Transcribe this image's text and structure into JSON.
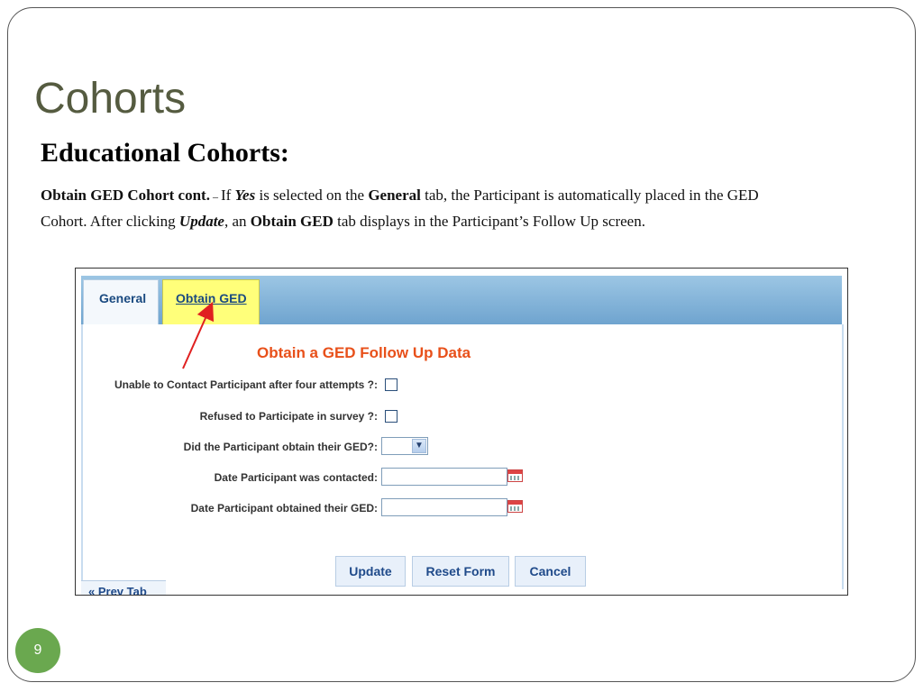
{
  "slide": {
    "title": "Cohorts",
    "subtitle": "Educational Cohorts:",
    "paragraph": {
      "lead": "Obtain GED Cohort cont.",
      "dash": " – ",
      "t1": "If ",
      "yes": "Yes",
      "t2": " is selected on the ",
      "general": "General",
      "t3": " tab, the Participant is automatically placed in the GED Cohort.  After clicking ",
      "update": "Update",
      "t4": ", an ",
      "obtain_ged": "Obtain GED",
      "t5": " tab displays in the Participant’s Follow Up screen."
    },
    "page_number": "9"
  },
  "screenshot": {
    "tabs": [
      {
        "label": "General",
        "active": false
      },
      {
        "label": "Obtain GED",
        "active": true,
        "highlight_color": "#ffff7a"
      }
    ],
    "form_title": "Obtain a GED Follow Up Data",
    "fields": {
      "unable_contact": {
        "label": "Unable to Contact Participant after four attempts ?:",
        "checked": false
      },
      "refused": {
        "label": "Refused to Participate in survey ?:",
        "checked": false
      },
      "obtain_ged": {
        "label": "Did the Participant obtain their GED?:",
        "value": ""
      },
      "date_contacted": {
        "label": "Date Participant was contacted:",
        "value": ""
      },
      "date_obtained": {
        "label": "Date Participant obtained their GED:",
        "value": ""
      }
    },
    "buttons": {
      "update": "Update",
      "reset": "Reset Form",
      "cancel": "Cancel"
    },
    "prev_tab": "« Prev Tab"
  },
  "colors": {
    "title": "#555b40",
    "form_title": "#e8501a",
    "accent_arrow": "#e02020",
    "badge": "#6aa84f"
  }
}
